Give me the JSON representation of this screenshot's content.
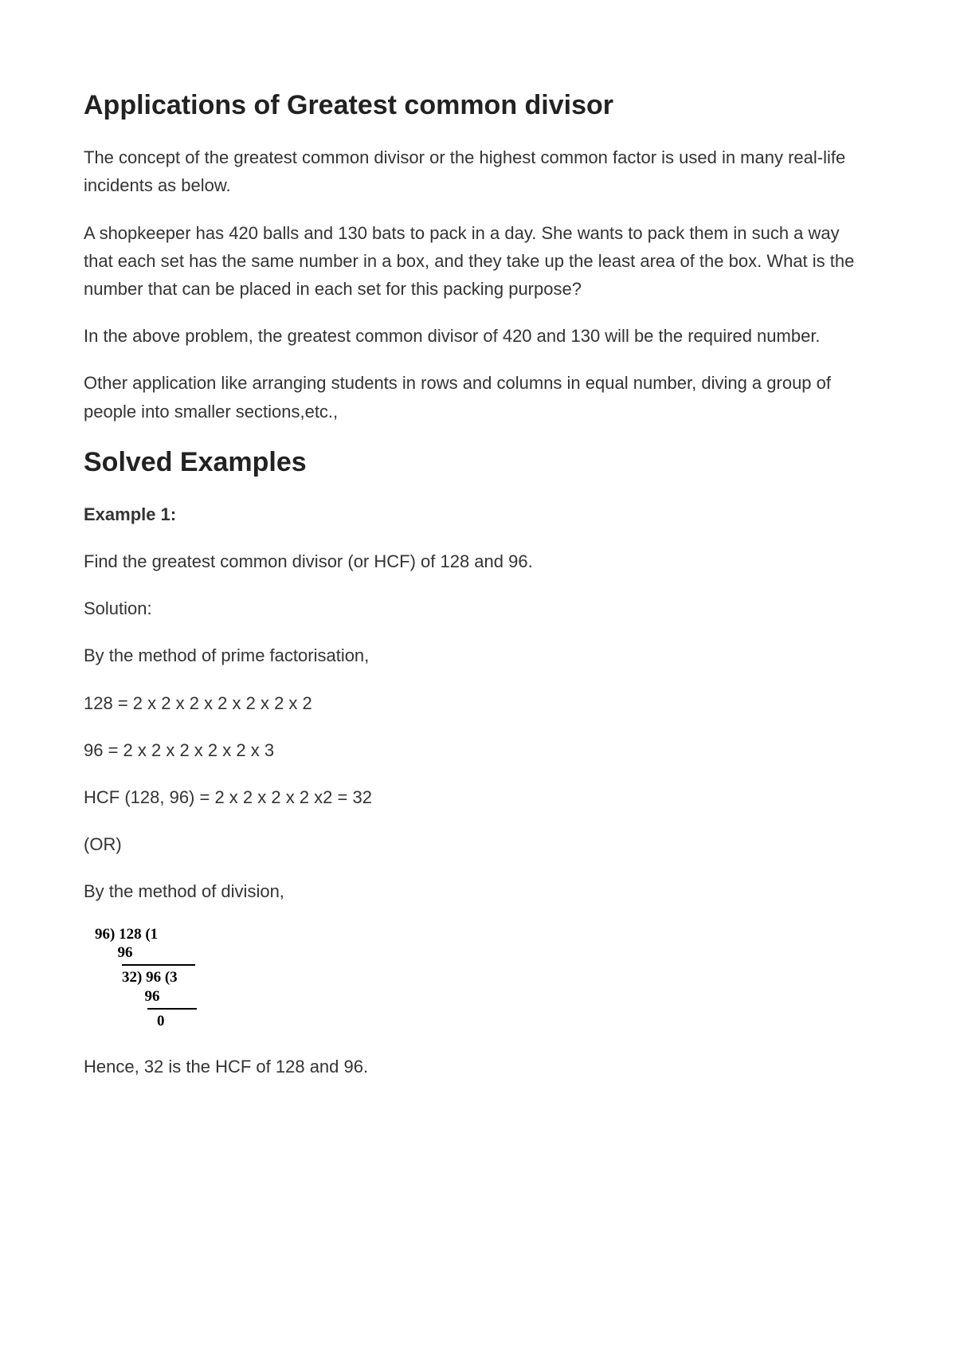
{
  "h1": "Applications of Greatest common divisor",
  "p1": "The concept of the greatest common divisor or the highest common factor is used in many real-life incidents as below.",
  "p2": "A shopkeeper has 420 balls and 130 bats to pack in a day. She wants to pack them in such a way that each set has the same number in a box, and they take up the least area of the box. What is the number that can be placed in each set for this packing purpose?",
  "p3": "In the above problem, the greatest common divisor of 420 and 130 will be the required number.",
  "p4": "Other application like arranging students in rows and columns in equal number, diving a group of people into smaller sections,etc.,",
  "h2": "Solved Examples",
  "ex1_label": "Example 1:",
  "ex1_q": "Find the greatest common divisor (or HCF) of 128 and 96.",
  "sol_label": "Solution:",
  "method1": "By the method of prime factorisation,",
  "line1": "128 = 2 x 2 x 2 x 2 x 2 x 2 x 2",
  "line2": "96 = 2 x 2 x 2 x 2 x 2 x 3",
  "line3": "HCF (128, 96) = 2 x 2 x 2 x 2 x2 = 32",
  "or": "(OR)",
  "method2": "By the method of division,",
  "div": {
    "r1": "96) 128 (1",
    "r2": "      96",
    "r3": "32) 96 (3",
    "r4": "      96",
    "r5": "0"
  },
  "conclusion": "Hence, 32 is the HCF of 128 and 96."
}
